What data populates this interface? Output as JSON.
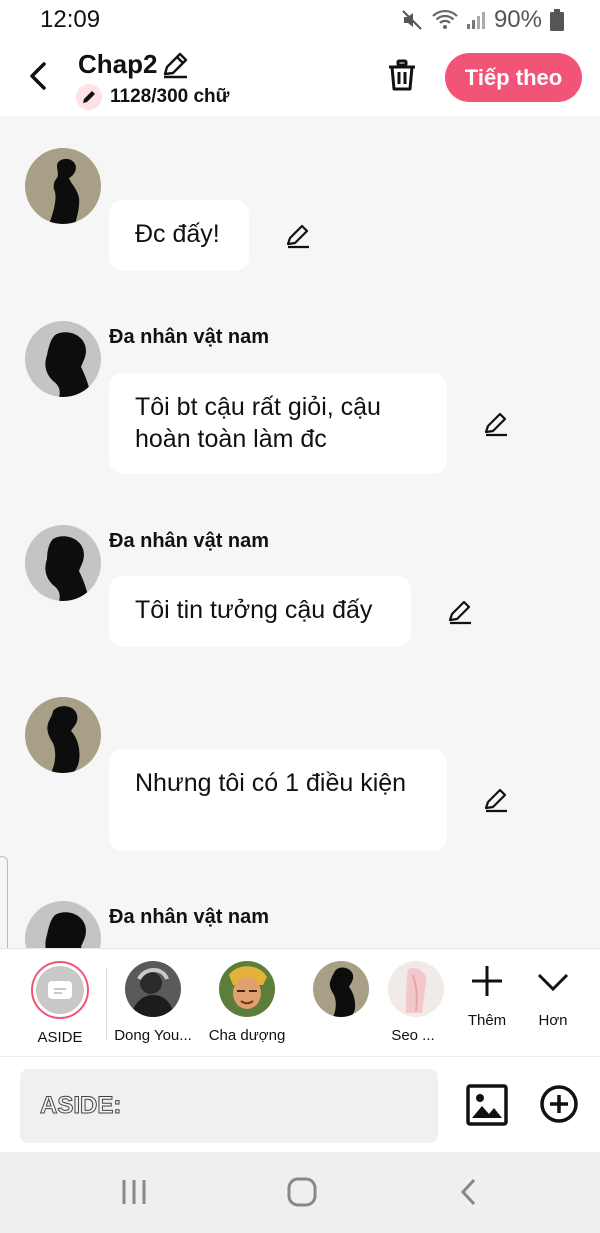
{
  "status": {
    "time": "12:09",
    "battery": "90%"
  },
  "header": {
    "title": "Chap2",
    "word_count": "1128/300 chữ",
    "next_label": "Tiếp theo"
  },
  "messages": [
    {
      "sender": "",
      "text": "Đc đấy!"
    },
    {
      "sender": "Đa nhân vật nam",
      "text": "Tôi bt cậu rất giỏi, cậu hoàn toàn làm đc"
    },
    {
      "sender": "Đa nhân vật nam",
      "text": "Tôi tin tưởng cậu đấy"
    },
    {
      "sender": "",
      "text": "Nhưng tôi có 1 điều kiện"
    },
    {
      "sender": "Đa nhân vật nam",
      "text": ""
    }
  ],
  "characters": {
    "items": [
      {
        "label": "ASIDE"
      },
      {
        "label": "Dong You..."
      },
      {
        "label": "Cha dượng"
      },
      {
        "label": ""
      },
      {
        "label": "Seo ..."
      }
    ],
    "more_label": "Thêm",
    "less_label": "Hơn"
  },
  "composer": {
    "placeholder": "ASIDE:"
  },
  "colors": {
    "accent": "#f25478",
    "background": "#f6f6f6"
  }
}
